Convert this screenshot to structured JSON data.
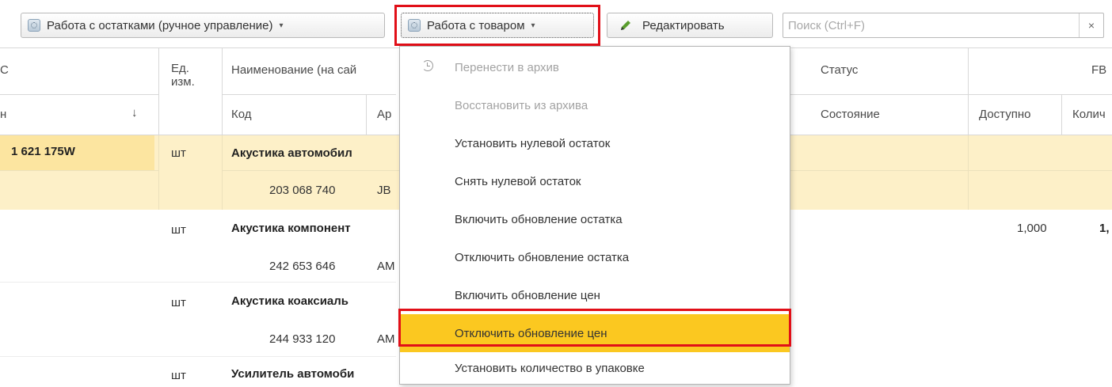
{
  "toolbar": {
    "stock_button": "Работа с остатками (ручное управление)",
    "goods_button": "Работа с товаром",
    "edit_button": "Редактировать",
    "search_placeholder": "Поиск (Ctrl+F)",
    "clear": "×",
    "dropdown_caret": "▾"
  },
  "table": {
    "headers": {
      "col0_top": "С",
      "col0_bottom": "н",
      "sort_arrow": "↓",
      "unit": "Ед.\nизм.",
      "name": "Наименование (на сай",
      "code": "Код",
      "article": "Ар",
      "status": "Статус",
      "state": "Состояние",
      "fb": "FB",
      "available": "Доступно",
      "quantity": "Колич"
    },
    "rows": [
      {
        "id": "1 621 175W",
        "unit": "шт",
        "name": "Акустика автомобил",
        "code": "203 068 740",
        "article": "JB"
      },
      {
        "id": "",
        "unit": "шт",
        "name": "Акустика компонент",
        "code": "242 653 646",
        "article": "AM",
        "available": "1,000",
        "quantity": "1,"
      },
      {
        "id": "",
        "unit": "шт",
        "name": "Акустика коаксиаль",
        "code": "244 933 120",
        "article": "AM"
      },
      {
        "id": "",
        "unit": "шт",
        "name": "Усилитель автомоби",
        "code": "",
        "article": ""
      }
    ]
  },
  "menu": {
    "items": [
      {
        "label": "Перенести в архив",
        "disabled": true
      },
      {
        "label": "Восстановить из архива",
        "disabled": true
      },
      {
        "label": "Установить нулевой остаток"
      },
      {
        "label": "Снять нулевой остаток"
      },
      {
        "label": "Включить обновление остатка"
      },
      {
        "label": "Отключить обновление остатка"
      },
      {
        "label": "Включить обновление цен"
      },
      {
        "label": "Отключить обновление цен",
        "active": true
      },
      {
        "label": "Установить количество в упаковке"
      }
    ]
  },
  "colors": {
    "selected_row": "#fdf0c8",
    "selected_cell": "#fce5a0",
    "active_menu_item": "#fbc820",
    "highlight_border": "#e10f18"
  }
}
